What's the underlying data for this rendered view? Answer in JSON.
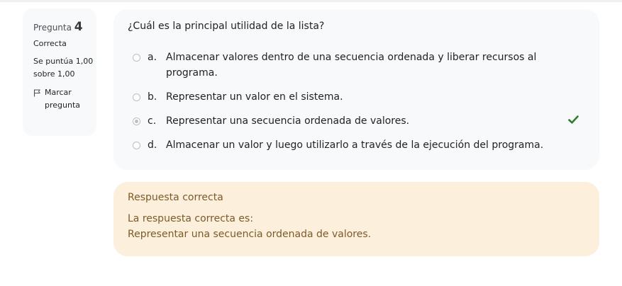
{
  "question": {
    "label": "Pregunta",
    "number": "4",
    "state": "Correcta",
    "grade": "Se puntúa 1,00 sobre 1,00",
    "flag_label": "Marcar pregunta",
    "text": "¿Cuál es la principal utilidad de la lista?",
    "options": [
      {
        "letter": "a.",
        "text": "Almacenar valores dentro de una secuencia ordenada y liberar recursos al programa.",
        "selected": false
      },
      {
        "letter": "b.",
        "text": "Representar un valor en el sistema.",
        "selected": false
      },
      {
        "letter": "c.",
        "text": "Representar una secuencia ordenada de valores.",
        "selected": true
      },
      {
        "letter": "d.",
        "text": "Almacenar un valor y luego utilizarlo a través de la ejecución del programa.",
        "selected": false
      }
    ]
  },
  "feedback": {
    "title": "Respuesta correcta",
    "intro": "La respuesta correcta es:",
    "answer": "Representar una secuencia ordenada de valores."
  },
  "colors": {
    "correct_check": "#357a32",
    "feedback_bg": "#fcefdc",
    "feedback_text": "#7d5a29"
  }
}
